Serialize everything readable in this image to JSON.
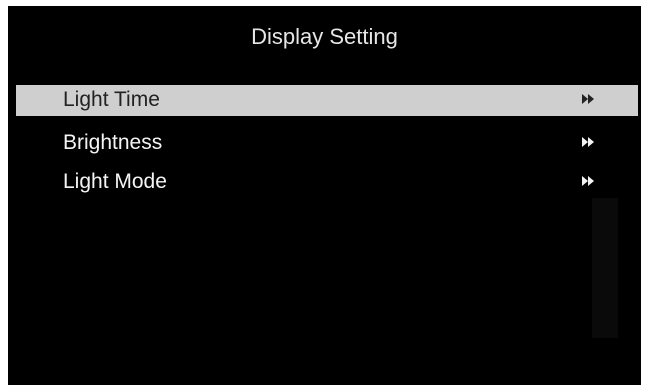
{
  "screen": {
    "title": "Display Setting"
  },
  "menu": {
    "items": [
      {
        "label": "Light Time",
        "selected": true,
        "icon": "double-arrow-right-icon"
      },
      {
        "label": "Brightness",
        "selected": false,
        "icon": "double-arrow-right-icon"
      },
      {
        "label": "Light Mode",
        "selected": false,
        "icon": "double-arrow-right-icon"
      }
    ]
  },
  "colors": {
    "background": "#000000",
    "selection": "#cfcfcf",
    "text": "#f4f4f4",
    "selected_text": "#222222"
  }
}
